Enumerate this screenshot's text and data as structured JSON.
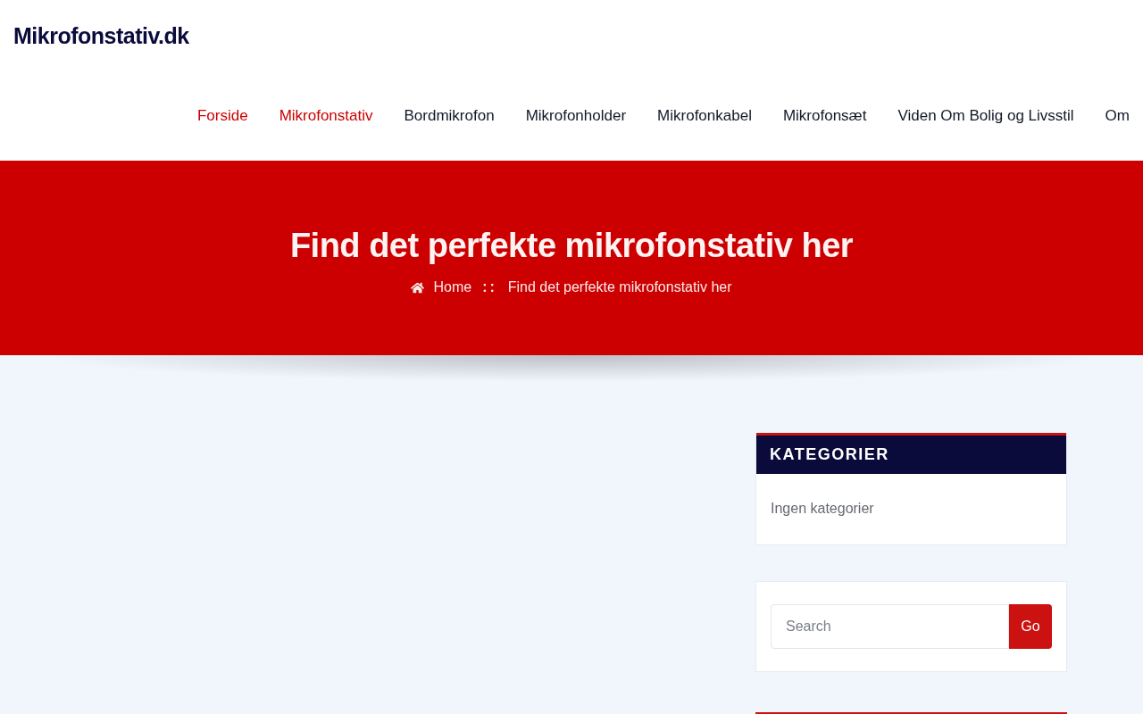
{
  "site": {
    "title": "Mikrofonstativ.dk"
  },
  "nav": {
    "items": [
      {
        "label": "Forside",
        "selected": true
      },
      {
        "label": "Mikrofonstativ",
        "selected": true
      },
      {
        "label": "Bordmikrofon",
        "selected": false
      },
      {
        "label": "Mikrofonholder",
        "selected": false
      },
      {
        "label": "Mikrofonkabel",
        "selected": false
      },
      {
        "label": "Mikrofonsæt",
        "selected": false
      },
      {
        "label": "Viden Om Bolig og Livsstil",
        "selected": false
      },
      {
        "label": "Om",
        "selected": false
      }
    ]
  },
  "hero": {
    "title": "Find det perfekte mikrofonstativ her",
    "breadcrumb": [
      {
        "kind": "home",
        "label": "Home"
      },
      {
        "kind": "separator",
        "label": "::"
      },
      {
        "kind": "current",
        "label": "Find det perfekte mikrofonstativ her"
      }
    ]
  },
  "sidebar": {
    "widgets": [
      {
        "kind": "list",
        "title": "KATEGORIER",
        "text": "Ingen kategorier"
      },
      {
        "kind": "search",
        "placeholder": "Search",
        "button": "Go"
      },
      {
        "kind": "partial"
      }
    ]
  }
}
